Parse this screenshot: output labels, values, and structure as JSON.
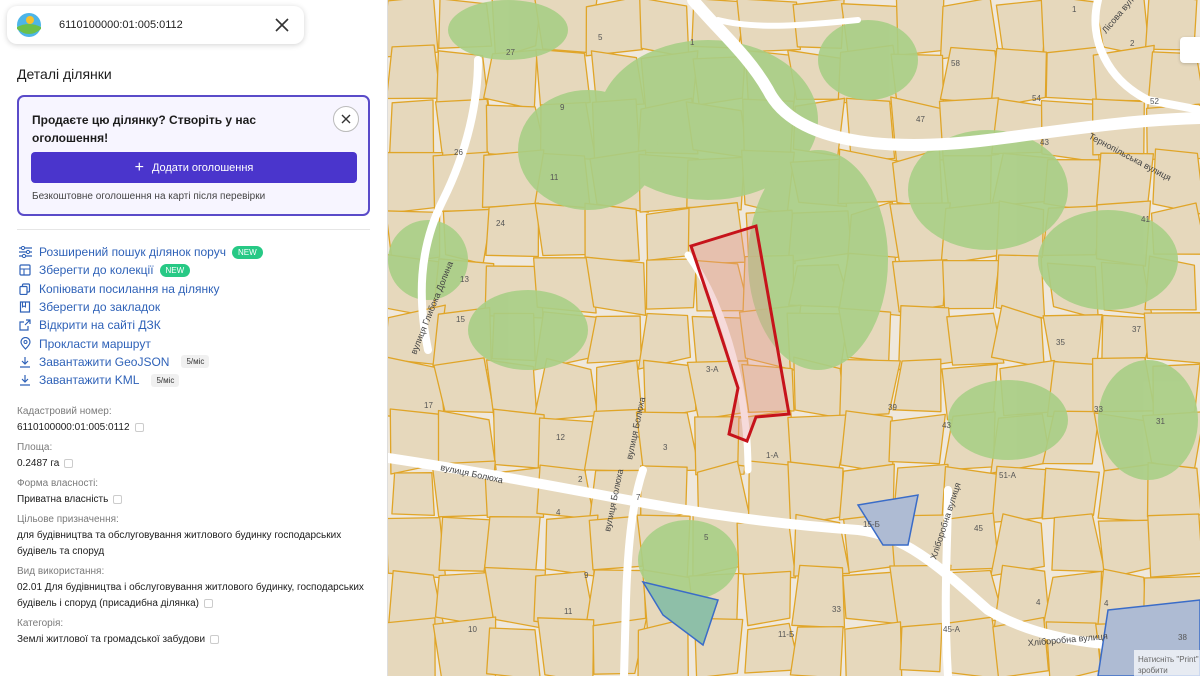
{
  "search": {
    "value": "6110100000:01:005:0112"
  },
  "panel": {
    "title": "Деталі ділянки",
    "promo": {
      "title": "Продаєте цю ділянку? Створіть у нас оголошення!",
      "button_label": "Додати оголошення",
      "note": "Безкоштовне оголошення на карті після перевірки"
    },
    "actions": [
      {
        "label": "Розширений пошук ділянок поруч",
        "badge": "NEW",
        "icon": "filter-icon"
      },
      {
        "label": "Зберегти до колекції",
        "badge": "NEW",
        "icon": "collection-icon"
      },
      {
        "label": "Копіювати посилання на ділянку",
        "icon": "link-icon"
      },
      {
        "label": "Зберегти до закладок",
        "icon": "bookmark-icon"
      },
      {
        "label": "Відкрити на сайті ДЗК",
        "icon": "external-link-icon"
      },
      {
        "label": "Прокласти маршрут",
        "icon": "location-pin-icon"
      },
      {
        "label": "Завантажити GeoJSON",
        "limit": "5/міс",
        "icon": "download-icon"
      },
      {
        "label": "Завантажити KML",
        "limit": "5/міс",
        "icon": "download-icon"
      }
    ],
    "properties": [
      {
        "label": "Кадастровий номер:",
        "value": "6110100000:01:005:0112"
      },
      {
        "label": "Площа:",
        "value": "0.2487 га"
      },
      {
        "label": "Форма власності:",
        "value": "Приватна власність"
      },
      {
        "label": "Цільове призначення:",
        "value": "для будівництва та обслуговування житлового будинку господарських будівель та споруд"
      },
      {
        "label": "Вид використання:",
        "value": "02.01 Для будівництва і обслуговування житлового будинку, господарських будівель і споруд (присадибна ділянка)"
      },
      {
        "label": "Категорія:",
        "value": "Землі житлової та громадської забудови"
      }
    ]
  },
  "map": {
    "streets": [
      "вулиця Глибока Долина",
      "вулиця Болюха",
      "вулиця Болюха",
      "вулиця Болюха",
      "Тернопільська вулиця",
      "Хліборобна вулиця",
      "Хліборобна вулиця",
      "Лісова вулиця"
    ],
    "house_numbers": [
      "5",
      "1",
      "27",
      "9",
      "11",
      "26",
      "24",
      "13",
      "15",
      "17",
      "12",
      "2",
      "4",
      "3",
      "3-А",
      "1-А",
      "7",
      "5",
      "9",
      "11",
      "10",
      "11-Б",
      "33",
      "47",
      "43",
      "41",
      "37",
      "35",
      "33",
      "31",
      "39",
      "43",
      "45",
      "51-А",
      "15-Б",
      "45-А",
      "4",
      "2",
      "58",
      "4",
      "1",
      "54",
      "52",
      "38"
    ],
    "print_note": "Натисніть \"Print\" зробити скріншот",
    "colors": {
      "parcel_fill": "#e6d8bc",
      "parcel_border": "#e0a528",
      "forest": "#a9cf86",
      "road": "#ffffff",
      "selected": "#c6131b",
      "accent": "#4a35cc"
    }
  }
}
